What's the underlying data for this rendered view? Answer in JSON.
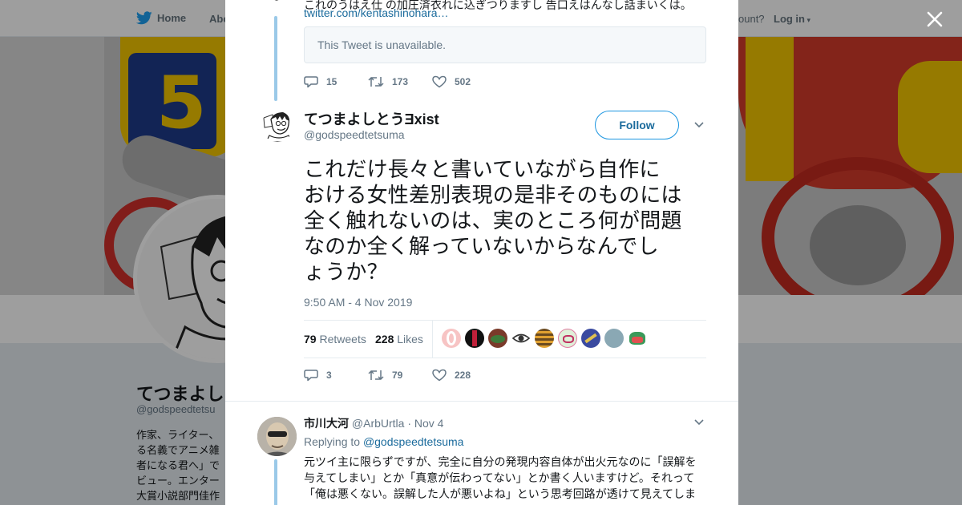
{
  "background": {
    "nav": {
      "home": "Home",
      "about": "Abo",
      "account": "ccount?",
      "login": "Log in"
    },
    "profile": {
      "name": "てつまよし",
      "handle": "@godspeedtetsu",
      "bio": [
        "作家、ライター、",
        "る名義でアニメ雑",
        "者になる君へ」で",
        "ビュー。エンター",
        "大賞小説部門佳作"
      ]
    }
  },
  "prev_tweet": {
    "text_fragment": "これのうはえ仕  の加圧済衣れに込ぎつりますし  告口えはんなし話まいくは。",
    "link": "twitter.com/kentashinohara…",
    "quote_unavailable": "This Tweet is unavailable.",
    "replies": "15",
    "retweets": "173",
    "likes": "502"
  },
  "main_tweet": {
    "display_name": "てつまよしとうƎxist",
    "handle": "@godspeedtetsuma",
    "follow_label": "Follow",
    "text_lines": [
      "これだけ長々と書いていながら自作に",
      "おける女性差別表現の是非そのものには",
      "全く触れないのは、実のところ何が問題",
      "なのか全く解っていないからなんでし",
      "ょうか？"
    ],
    "timestamp": "9:50 AM - 4 Nov 2019",
    "retweet_count": "79",
    "retweets_label": "Retweets",
    "like_count": "228",
    "likes_label": "Likes",
    "replies": "3",
    "retweets": "79",
    "likes": "228"
  },
  "reply": {
    "display_name": "市川大河",
    "handle": "@ArbUrtla",
    "date": "· Nov 4",
    "replying_prefix": "Replying to",
    "replying_handle": "@godspeedtetsuma",
    "text_lines": [
      "元ツイ主に限らずですが、完全に自分の発現内容自体が出火元なのに「誤解を",
      "与えてしまい」とか「真意が伝わってない」とか書く人いますけど。それって",
      "「俺は悪くない。誤解した人が悪いよね」という思考回路が透けて見えてしま"
    ]
  },
  "colors": {
    "twitter_blue": "#1da1f2",
    "link": "#1b6b9c",
    "muted": "#657786",
    "thread_line": "#9ac9e8"
  },
  "icons": [
    "twitter-bird-icon",
    "close-icon",
    "reply-icon",
    "retweet-icon",
    "heart-icon",
    "chevron-down-icon"
  ]
}
